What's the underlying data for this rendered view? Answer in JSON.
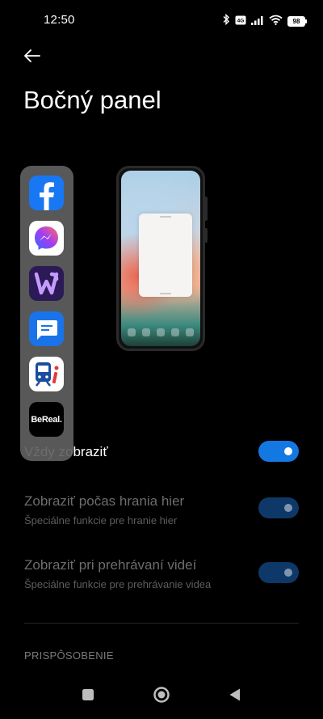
{
  "status_bar": {
    "time": "12:50",
    "network_badge": "4G",
    "battery_level": "98",
    "icons": [
      "bluetooth-icon",
      "network-type-icon",
      "signal-icon",
      "wifi-icon",
      "battery-icon"
    ]
  },
  "header": {
    "back_icon": "back-arrow-icon",
    "title": "Bočný panel"
  },
  "sidebar_preview": {
    "apps": [
      {
        "name": "facebook-app-icon",
        "color": "#1877f2"
      },
      {
        "name": "messenger-app-icon",
        "color": "#ffffff"
      },
      {
        "name": "w-app-icon",
        "color": "#2b1a55"
      },
      {
        "name": "messages-app-icon",
        "color": "#1a73e8"
      },
      {
        "name": "transit-app-icon",
        "color": "#ffffff"
      },
      {
        "name": "bereal-app-icon",
        "color": "#000000",
        "label": "BeReal."
      }
    ]
  },
  "settings": {
    "always_show": {
      "title": "Vždy zobraziť",
      "enabled": true
    },
    "show_during_games": {
      "title": "Zobraziť počas hrania hier",
      "subtitle": "Špeciálne funkcie pre hranie hier",
      "enabled": true,
      "disabled": true
    },
    "show_during_videos": {
      "title": "Zobraziť pri prehrávaní videí",
      "subtitle": "Špeciálne funkcie pre prehrávanie videa",
      "enabled": true,
      "disabled": true
    },
    "section_customization": "PRISPÔSOBENIE"
  },
  "colors": {
    "background": "#000000",
    "toggle_on": "#1478e3",
    "toggle_disabled": "#0e3868",
    "text_dim": "#6c6c6c"
  },
  "nav_bar": {
    "icons": [
      "recents-square-icon",
      "home-circle-icon",
      "back-triangle-icon"
    ]
  }
}
